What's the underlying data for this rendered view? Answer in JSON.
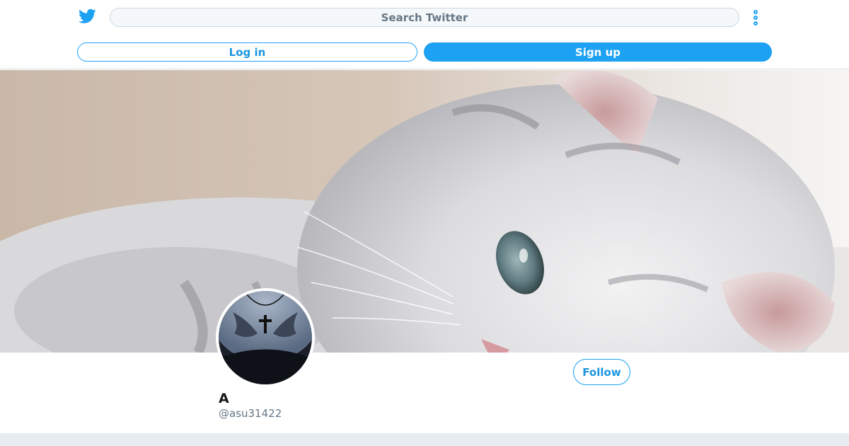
{
  "header": {
    "logo_icon": "twitter-bird-icon",
    "search_placeholder": "Search Twitter",
    "more_icon": "more-vertical-icon",
    "login_label": "Log in",
    "signup_label": "Sign up"
  },
  "profile": {
    "banner_image": "banner-kitten-photo",
    "avatar_image": "avatar-winged-cross-photo",
    "display_name": "A",
    "handle": "@asu31422",
    "follow_label": "Follow"
  },
  "colors": {
    "brand_blue": "#1da1f2",
    "text_dark": "#14171a",
    "text_muted": "#657786",
    "strip_gray": "#e6ecf0"
  }
}
